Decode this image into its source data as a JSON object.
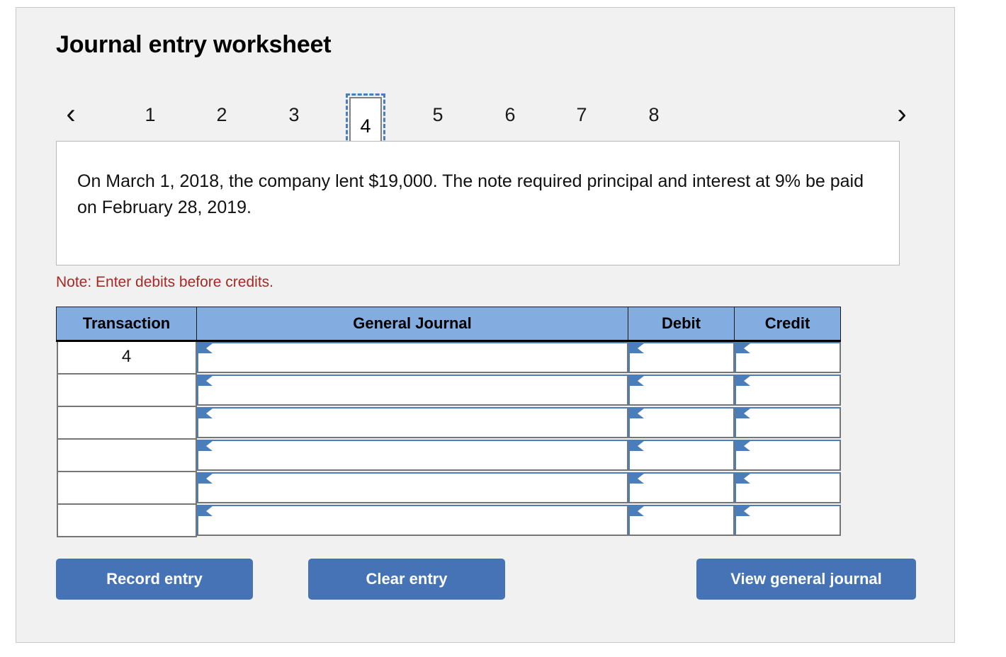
{
  "page": {
    "title": "Journal entry worksheet"
  },
  "pager": {
    "prev_icon": "chevron-left-icon",
    "next_icon": "chevron-right-icon",
    "prev_label": "‹",
    "next_label": "›",
    "pages": [
      "1",
      "2",
      "3",
      "4",
      "5",
      "6",
      "7",
      "8"
    ],
    "active_page": "4"
  },
  "description": {
    "text": "On March 1, 2018, the company lent $19,000. The note required principal and interest at 9% be paid on February 28, 2019."
  },
  "note": {
    "text": "Note: Enter debits before credits."
  },
  "table": {
    "headers": {
      "transaction": "Transaction",
      "general_journal": "General Journal",
      "debit": "Debit",
      "credit": "Credit"
    },
    "rows": [
      {
        "transaction": "4",
        "general_journal": "",
        "debit": "",
        "credit": ""
      },
      {
        "transaction": "",
        "general_journal": "",
        "debit": "",
        "credit": ""
      },
      {
        "transaction": "",
        "general_journal": "",
        "debit": "",
        "credit": ""
      },
      {
        "transaction": "",
        "general_journal": "",
        "debit": "",
        "credit": ""
      },
      {
        "transaction": "",
        "general_journal": "",
        "debit": "",
        "credit": ""
      },
      {
        "transaction": "",
        "general_journal": "",
        "debit": "",
        "credit": ""
      }
    ]
  },
  "buttons": {
    "record": "Record entry",
    "clear": "Clear entry",
    "view": "View general journal"
  },
  "colors": {
    "header_blue": "#83ace0",
    "button_blue": "#4573b5",
    "input_border_blue": "#4a7ebb",
    "note_red": "#a32b23",
    "card_bg": "#f1f1f1"
  }
}
